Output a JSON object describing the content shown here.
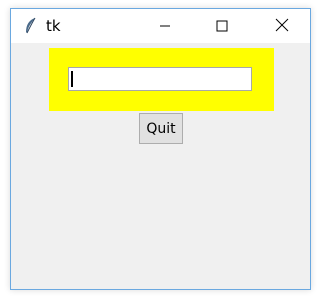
{
  "window": {
    "title": "tk",
    "controls": {
      "minimize": "minimize-icon",
      "maximize": "maximize-icon",
      "close": "close-icon"
    }
  },
  "frame": {
    "background_color": "#ffff00"
  },
  "entry": {
    "value": "",
    "placeholder": ""
  },
  "buttons": {
    "quit_label": "Quit"
  },
  "colors": {
    "window_bg": "#f0f0f0",
    "titlebar_bg": "#ffffff",
    "accent_border": "#6aa8e0"
  }
}
